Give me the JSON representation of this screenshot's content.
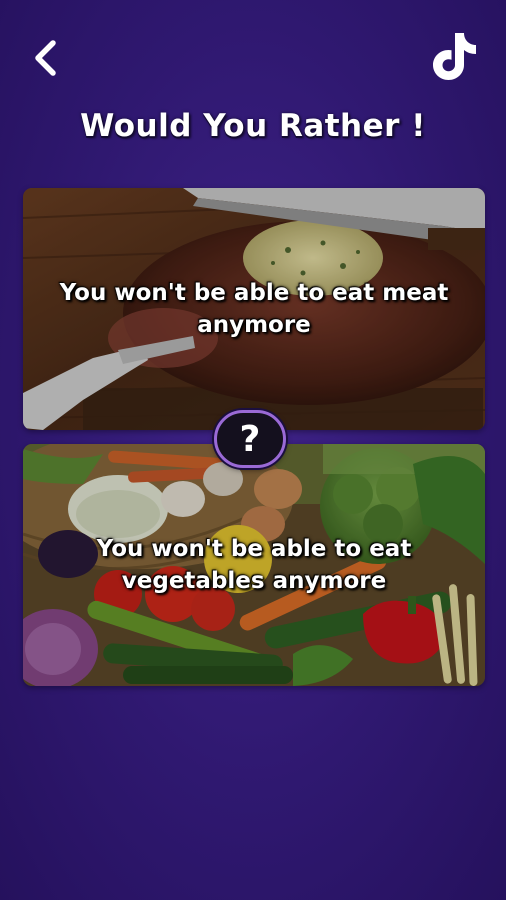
{
  "header": {
    "back_icon": "chevron-left-icon",
    "share_icon": "tiktok-icon",
    "title": "Would You Rather !"
  },
  "options": [
    {
      "label": "You won't be able to eat meat anymore",
      "image": "steak-photo"
    },
    {
      "label": "You won't be able to eat vegetables anymore",
      "image": "vegetables-photo"
    }
  ],
  "divider": {
    "symbol": "?"
  },
  "colors": {
    "background": "#2f1870",
    "badge_border": "#9a6ad6",
    "text": "#ffffff"
  }
}
